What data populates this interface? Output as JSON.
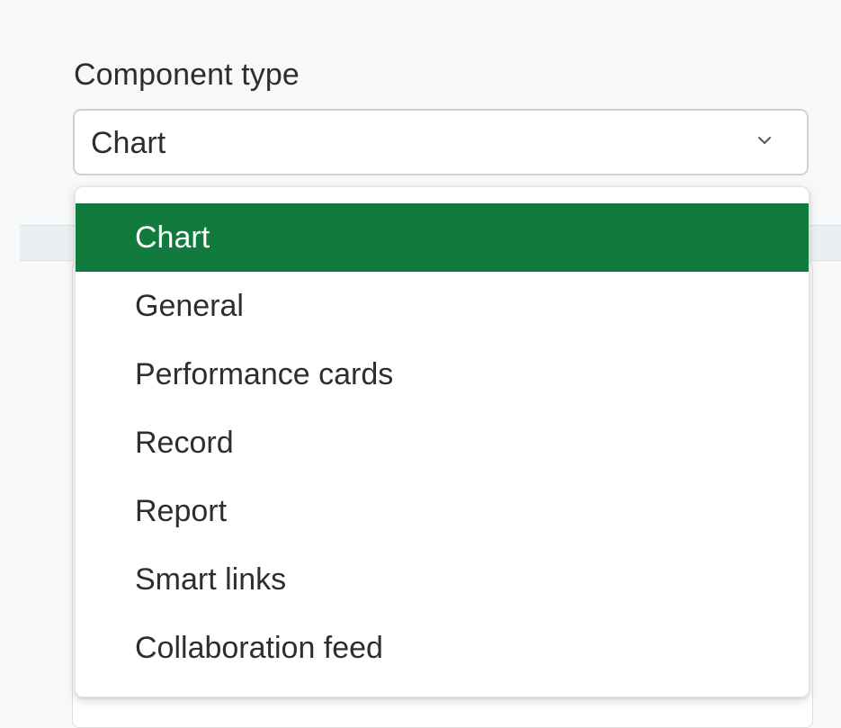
{
  "field": {
    "label": "Component type",
    "selected_value": "Chart",
    "chevron_icon": "chevron-down-icon"
  },
  "dropdown": {
    "options": [
      {
        "label": "Chart",
        "selected": true
      },
      {
        "label": "General",
        "selected": false
      },
      {
        "label": "Performance cards",
        "selected": false
      },
      {
        "label": "Record",
        "selected": false
      },
      {
        "label": "Report",
        "selected": false
      },
      {
        "label": "Smart links",
        "selected": false
      },
      {
        "label": "Collaboration feed",
        "selected": false
      }
    ]
  },
  "colors": {
    "selected_bg": "#137a3e",
    "selected_text": "#ffffff",
    "text": "#2e2e2e",
    "border": "#cdd2d6"
  }
}
